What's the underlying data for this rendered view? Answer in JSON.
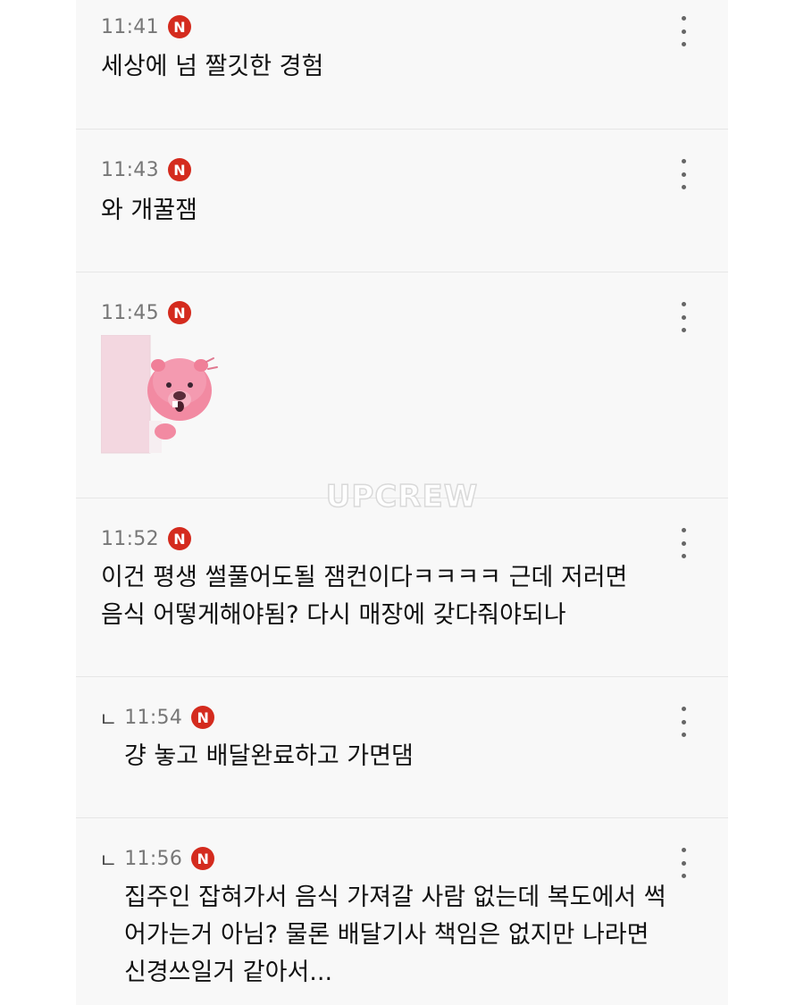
{
  "badge_letter": "N",
  "reply_mark": "ㄴ",
  "watermark": "UPCREW",
  "comments": [
    {
      "time": "11:41",
      "text": "세상에 넘 짤깃한 경험"
    },
    {
      "time": "11:43",
      "text": "와 개꿀잼"
    },
    {
      "time": "11:45",
      "sticker": "pink-beaver-peeking-sticker"
    },
    {
      "time": "11:52",
      "lines": [
        "이건 평생 썰풀어도될 잼컨이다ㅋㅋㅋㅋ 근데 저러면",
        "음식 어떻게해야됨? 다시 매장에 갖다줘야되나"
      ]
    },
    {
      "time": "11:54",
      "reply": true,
      "text": "걍 놓고 배달완료하고 가면댐"
    },
    {
      "time": "11:56",
      "reply": true,
      "lines": [
        "집주인 잡혀가서 음식 가져갈 사람 없는데 복도에서 썩",
        "어가는거 아님? 물론 배달기사 책임은 없지만 나라면",
        "신경쓰일거 같아서..."
      ]
    }
  ],
  "colors": {
    "badge": "#d42b1e",
    "background": "#f8f8f8"
  }
}
